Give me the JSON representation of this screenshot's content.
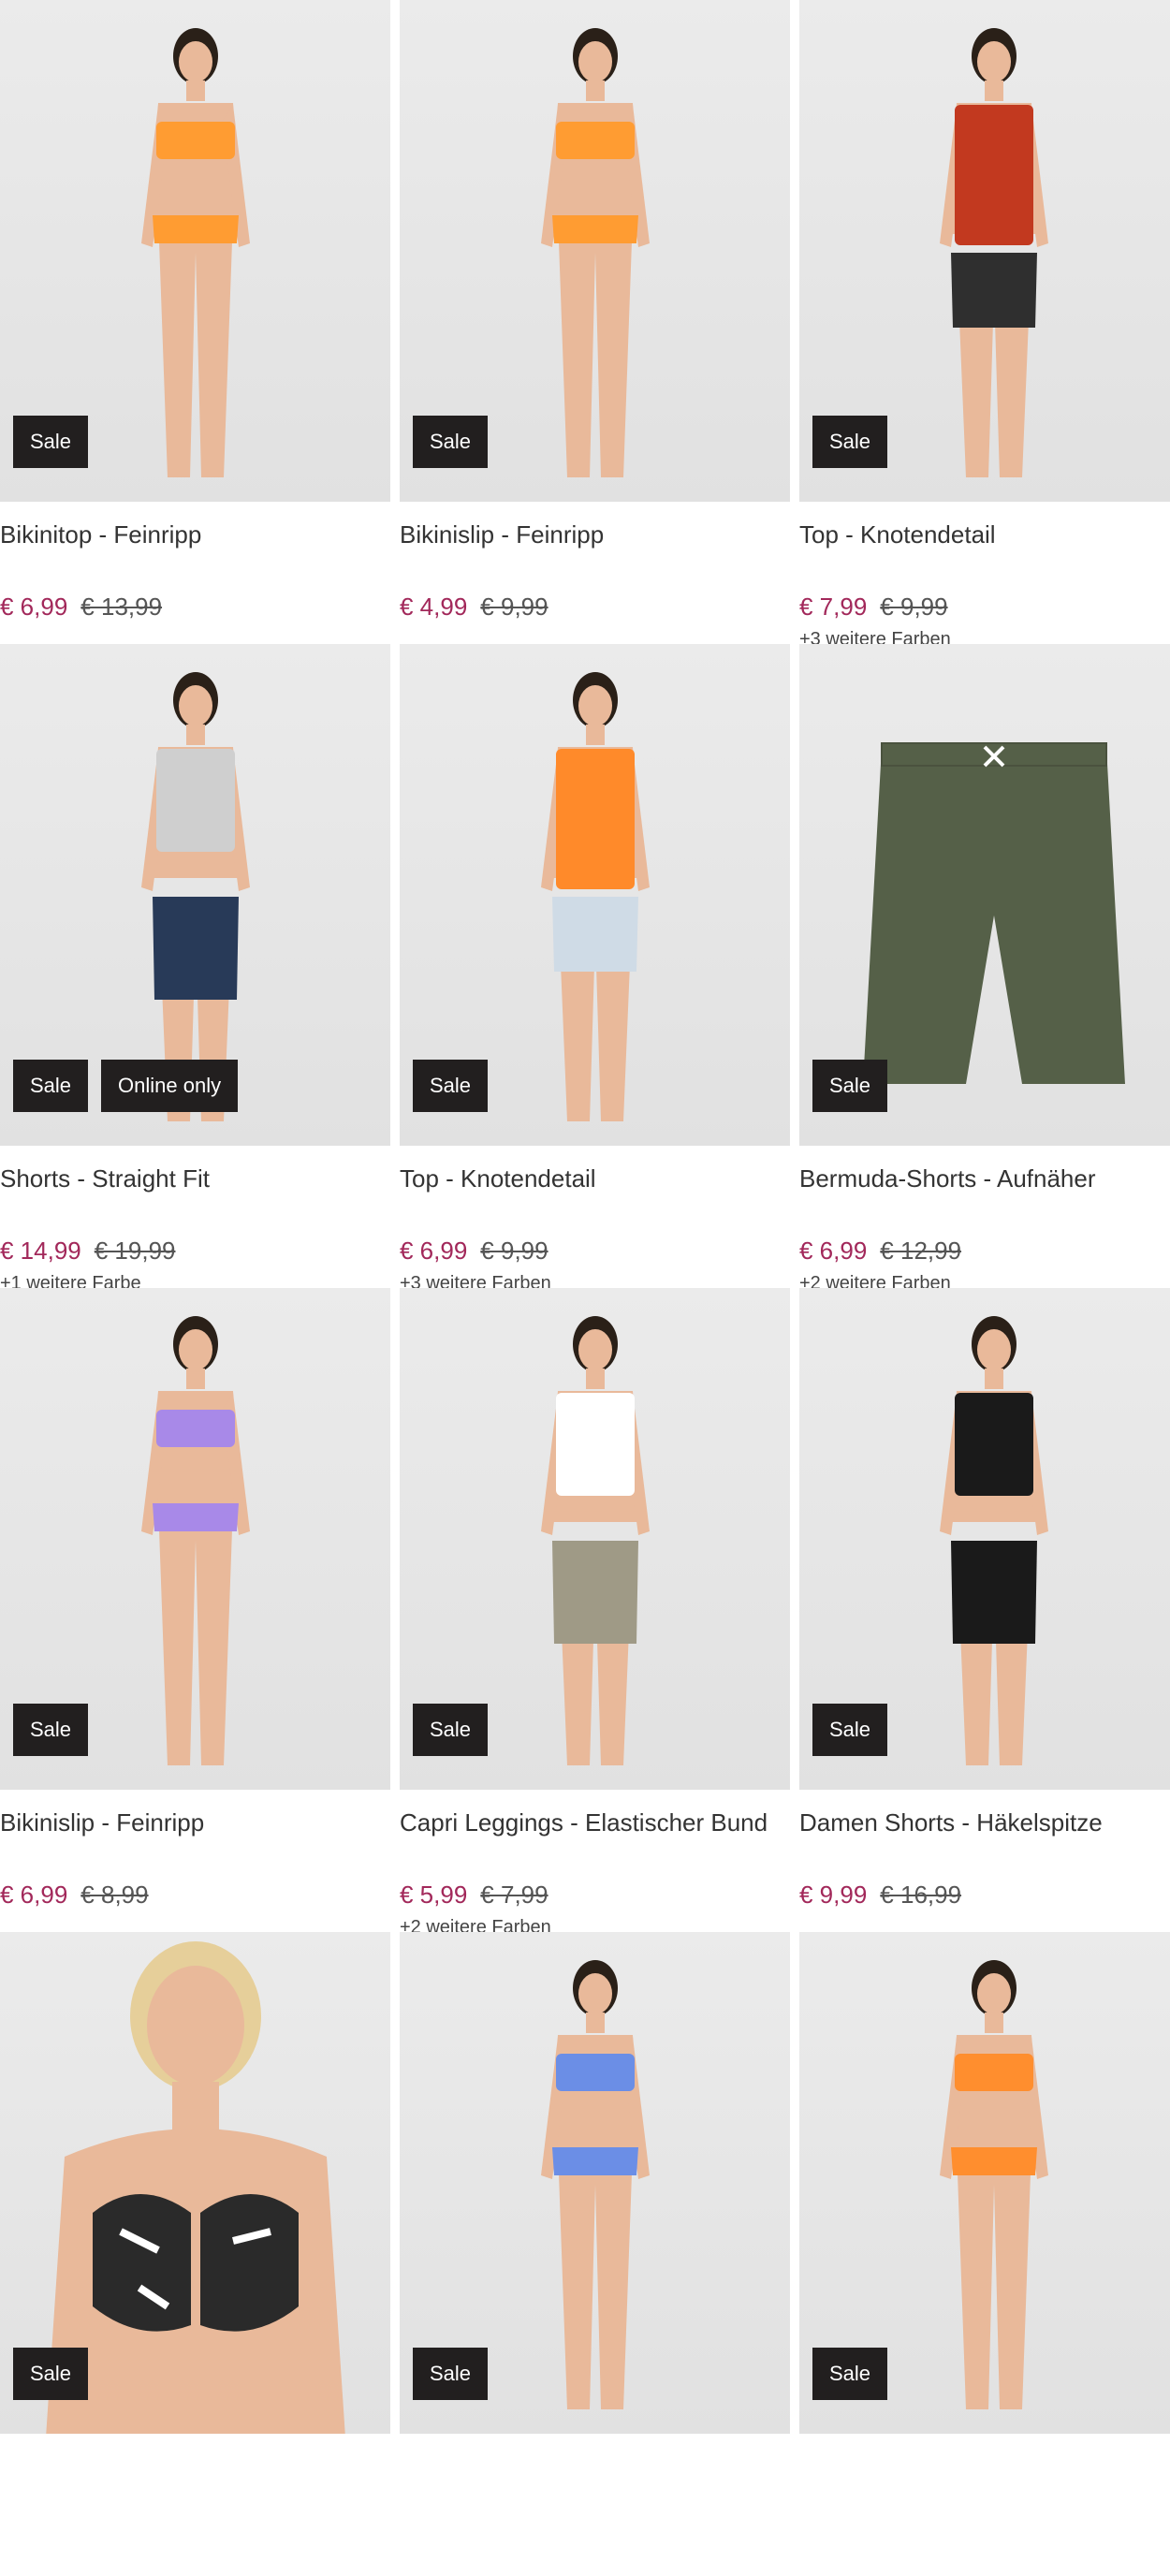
{
  "labels": {
    "sale": "Sale",
    "online_only": "Online only"
  },
  "products": [
    {
      "name": "Bikinitop - Feinripp",
      "price": "€ 6,99",
      "old_price": "€ 13,99",
      "colors": "",
      "badges": [
        "Sale"
      ],
      "garment": "#ff9c32",
      "bottom": "#ff9c32",
      "pose": "bikini"
    },
    {
      "name": "Bikinislip - Feinripp",
      "price": "€ 4,99",
      "old_price": "€ 9,99",
      "colors": "",
      "badges": [
        "Sale"
      ],
      "garment": "#ff9c32",
      "bottom": "#ff9c32",
      "pose": "bikini"
    },
    {
      "name": "Top - Knotendetail",
      "price": "€ 7,99",
      "old_price": "€ 9,99",
      "colors": "+3 weitere Farben",
      "badges": [
        "Sale"
      ],
      "garment": "#c2391f",
      "bottom": "#2f2f2f",
      "pose": "top"
    },
    {
      "name": "Shorts - Straight Fit",
      "price": "€ 14,99",
      "old_price": "€ 19,99",
      "colors": "+1 weitere Farbe",
      "badges": [
        "Sale",
        "Online only"
      ],
      "garment": "#cfcfcf",
      "bottom": "#283a58",
      "pose": "full"
    },
    {
      "name": "Top - Knotendetail",
      "price": "€ 6,99",
      "old_price": "€ 9,99",
      "colors": "+3 weitere Farben",
      "badges": [
        "Sale"
      ],
      "garment": "#ff8a2a",
      "bottom": "#cfdbe6",
      "pose": "top"
    },
    {
      "name": "Bermuda-Shorts - Aufnäher",
      "price": "€ 6,99",
      "old_price": "€ 12,99",
      "colors": "+2 weitere Farben",
      "badges": [
        "Sale"
      ],
      "garment": "#556048",
      "bottom": "#556048",
      "pose": "shorts"
    },
    {
      "name": "Bikinislip - Feinripp",
      "price": "€ 6,99",
      "old_price": "€ 8,99",
      "colors": "",
      "badges": [
        "Sale"
      ],
      "garment": "#a889e8",
      "bottom": "#a889e8",
      "pose": "bikini"
    },
    {
      "name": "Capri Leggings - Elastischer Bund",
      "price": "€ 5,99",
      "old_price": "€ 7,99",
      "colors": "+2 weitere Farben",
      "badges": [
        "Sale"
      ],
      "garment": "#ffffff",
      "bottom": "#9f9a86",
      "pose": "full"
    },
    {
      "name": "Damen Shorts - Häkelspitze",
      "price": "€ 9,99",
      "old_price": "€ 16,99",
      "colors": "",
      "badges": [
        "Sale"
      ],
      "garment": "#1a1a1a",
      "bottom": "#1a1a1a",
      "pose": "full"
    },
    {
      "name": "",
      "price": "",
      "old_price": "",
      "colors": "",
      "badges": [
        "Sale"
      ],
      "garment": "#2a2a2a",
      "bottom": "#2a2a2a",
      "pose": "close"
    },
    {
      "name": "",
      "price": "",
      "old_price": "",
      "colors": "",
      "badges": [
        "Sale"
      ],
      "garment": "#6b8ee6",
      "bottom": "#6b8ee6",
      "pose": "bikini"
    },
    {
      "name": "",
      "price": "",
      "old_price": "",
      "colors": "",
      "badges": [
        "Sale"
      ],
      "garment": "#ff8e2e",
      "bottom": "#ff8e2e",
      "pose": "bikini"
    }
  ]
}
